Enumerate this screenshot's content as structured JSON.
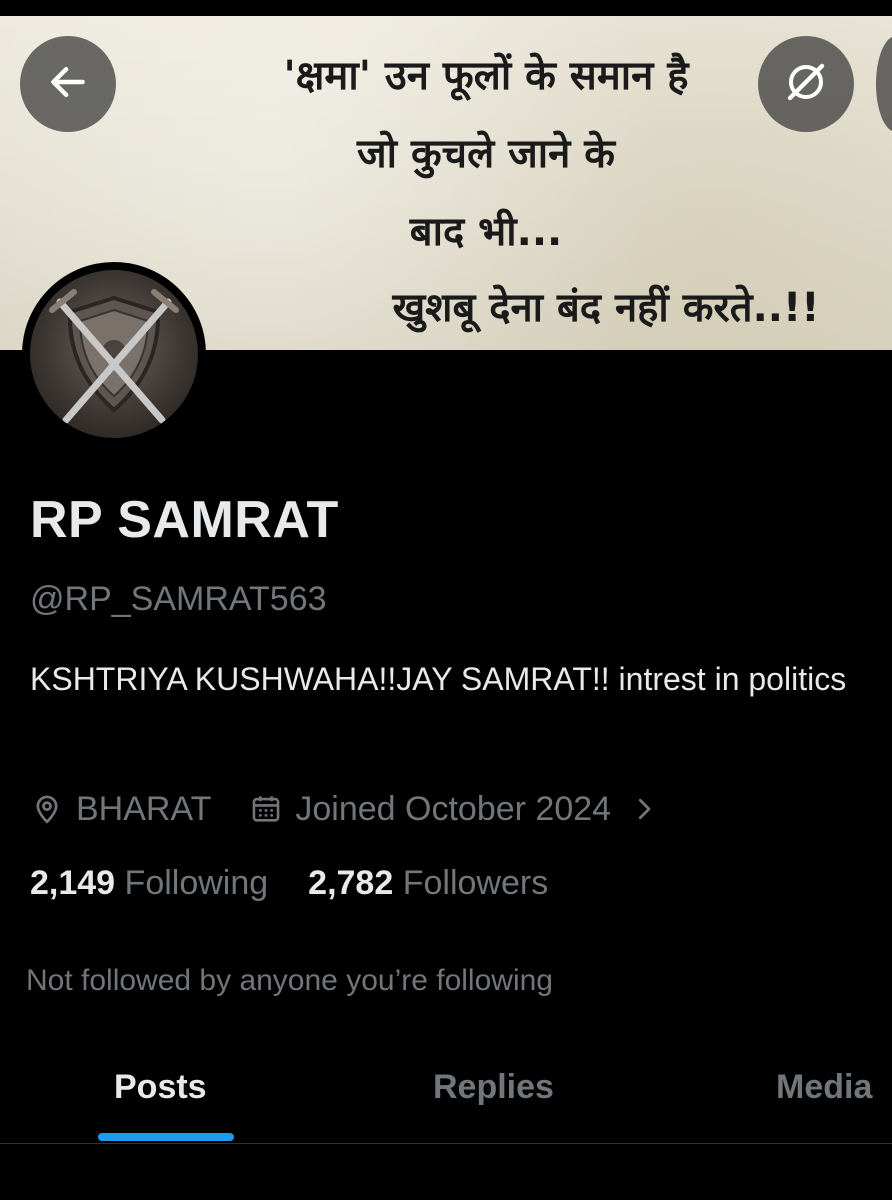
{
  "banner": {
    "line1": "'क्षमा' उन फूलों के समान है",
    "line2": "जो कुचले जाने के",
    "line3": "बाद भी...",
    "line4": "खुशबू देना बंद नहीं करते..!!"
  },
  "icons": {
    "back": "arrow-left-icon",
    "grok": "grok-icon",
    "location": "location-pin-icon",
    "calendar": "calendar-icon",
    "chevron": "chevron-right-icon"
  },
  "profile": {
    "name": "RP SAMRAT",
    "handle": "@RP_SAMRAT563",
    "bio": "KSHTRIYA KUSHWAHA!!JAY SAMRAT!! intrest in politics",
    "location": "BHARAT",
    "joined": "Joined October 2024",
    "following_count": "2,149",
    "following_label": "Following",
    "followers_count": "2,782",
    "followers_label": "Followers",
    "not_followed": "Not followed by anyone you’re following"
  },
  "tabs": [
    {
      "label": "Posts",
      "active": true
    },
    {
      "label": "Replies",
      "active": false
    },
    {
      "label": "Media",
      "active": false
    }
  ],
  "colors": {
    "accent": "#1d9bf0",
    "background": "#000000",
    "text_primary": "#e7e9ea",
    "text_secondary": "#71767b"
  }
}
